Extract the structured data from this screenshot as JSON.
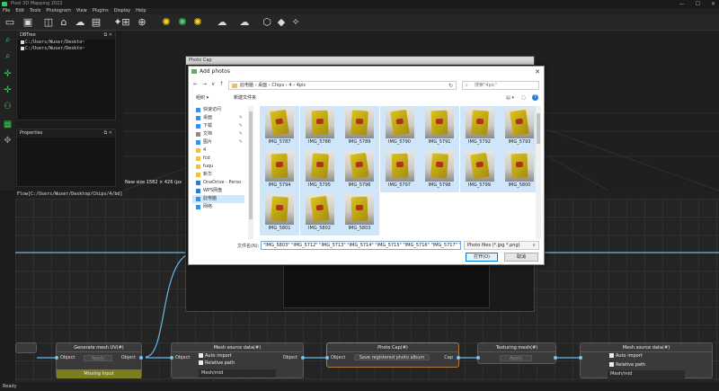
{
  "app": {
    "title": "Pixel 3D Mapping 2022",
    "window_controls": [
      "—",
      "☐",
      "✕"
    ]
  },
  "menu": [
    "File",
    "Edit",
    "Tools",
    "Photogram",
    "View",
    "PlugIns",
    "Display",
    "Help"
  ],
  "toolbar": [
    "open-icon",
    "save-icon",
    "camera-icon",
    "folder-icon",
    "cloud-icon",
    "terminal-icon",
    "settings-icon",
    "add-image-icon",
    "target-icon",
    "ring-icon",
    "gear-icon",
    "gear-icon",
    "gear-icon",
    "cloud-icon",
    "cloud-icon",
    "polygon-icon",
    "node-icon",
    "mesh-icon"
  ],
  "left_tools": [
    "zoom-icon",
    "zoom-fit-icon",
    "move-icon",
    "axis-icon",
    "nodes-icon",
    "grid-icon",
    "pan-icon"
  ],
  "dbtree": {
    "title": "DBTree",
    "items": [
      "C:/Users/Wuser/Deskto~",
      "C:/Users/Wuser/Deskto~"
    ]
  },
  "properties": {
    "title": "Properties"
  },
  "viewport": {
    "info": "New size 1582 × 426 (px"
  },
  "flow": {
    "path": "Flow[C:/Users/Wuser/Desktop/Chips/4/bd]"
  },
  "status": "Ready",
  "nodes": {
    "generate_mesh": {
      "title": "Generate mesh UV(#)",
      "in": "Object",
      "out": "Object",
      "button": "Apply",
      "warning": "Missing Input"
    },
    "mesh_source_1": {
      "title": "Mesh source data(#)",
      "in": "Object",
      "out": "Object",
      "auto_import": "Auto import",
      "relative_path": "Relative path",
      "field": "Mesh/mid"
    },
    "photo_cap": {
      "title": "Photo Cap(#)",
      "in": "Object",
      "action": "Save registered photo album",
      "out": "Cap"
    },
    "texturing": {
      "title": "Texturing mesh(#)",
      "button": "Apply"
    },
    "mesh_source_2": {
      "title": "Mesh source data(#)",
      "auto_import": "Auto import",
      "relative_path": "Relative path",
      "field": "Mesh/mid"
    }
  },
  "photo_cap_window": {
    "title": "Photo Cap"
  },
  "dialog": {
    "title": "Add photos",
    "close": "✕",
    "nav": [
      "←",
      "→",
      "∨",
      "↑"
    ],
    "address": "此电脑 › 桌面 › Chips › 4 › 4pic",
    "search_placeholder": "搜索\"4pic\"",
    "organize": "组织 ▾",
    "new_folder": "新建文件夹",
    "sidebar": [
      {
        "label": "快速访问",
        "icon": "star-icon",
        "color": "#3a8ee6"
      },
      {
        "label": "桌面",
        "icon": "desktop-icon",
        "color": "#3a8ee6"
      },
      {
        "label": "下载",
        "icon": "download-icon",
        "color": "#3a8ee6"
      },
      {
        "label": "文档",
        "icon": "documents-icon",
        "color": "#8a8a8a"
      },
      {
        "label": "图片",
        "icon": "pictures-icon",
        "color": "#3a8ee6"
      },
      {
        "label": "4",
        "icon": "folder-icon",
        "color": "#e9c44a"
      },
      {
        "label": "fcd",
        "icon": "folder-icon",
        "color": "#e9c44a"
      },
      {
        "label": "fuqu",
        "icon": "folder-icon",
        "color": "#e9c44a"
      },
      {
        "label": "新华",
        "icon": "folder-icon",
        "color": "#e9c44a"
      },
      {
        "label": "OneDrive - Perso",
        "icon": "cloud-icon",
        "color": "#2b7cd3"
      },
      {
        "label": "WPS网盘",
        "icon": "cloud-icon",
        "color": "#2b7cd3"
      },
      {
        "label": "此电脑",
        "icon": "computer-icon",
        "color": "#3a8ee6"
      },
      {
        "label": "网络",
        "icon": "network-icon",
        "color": "#3a8ee6"
      }
    ],
    "files": [
      "IMG_5787",
      "IMG_5788",
      "IMG_5789",
      "IMG_5790",
      "IMG_5791",
      "IMG_5792",
      "IMG_5793",
      "IMG_5794",
      "IMG_5795",
      "IMG_5796",
      "IMG_5797",
      "IMG_5798",
      "IMG_5799",
      "IMG_5800",
      "IMG_5801",
      "IMG_5802",
      "IMG_5803"
    ],
    "filename_label": "文件名(N):",
    "filename_value": "\"IMG_5803\" \"IMG_5712\" \"IMG_5713\" \"IMG_5714\" \"IMG_5715\" \"IMG_5716\" \"IMG_5717\" \"",
    "filetype": "Photo files (*.jpg *.png)",
    "open": "打开(O)",
    "cancel": "取消"
  }
}
